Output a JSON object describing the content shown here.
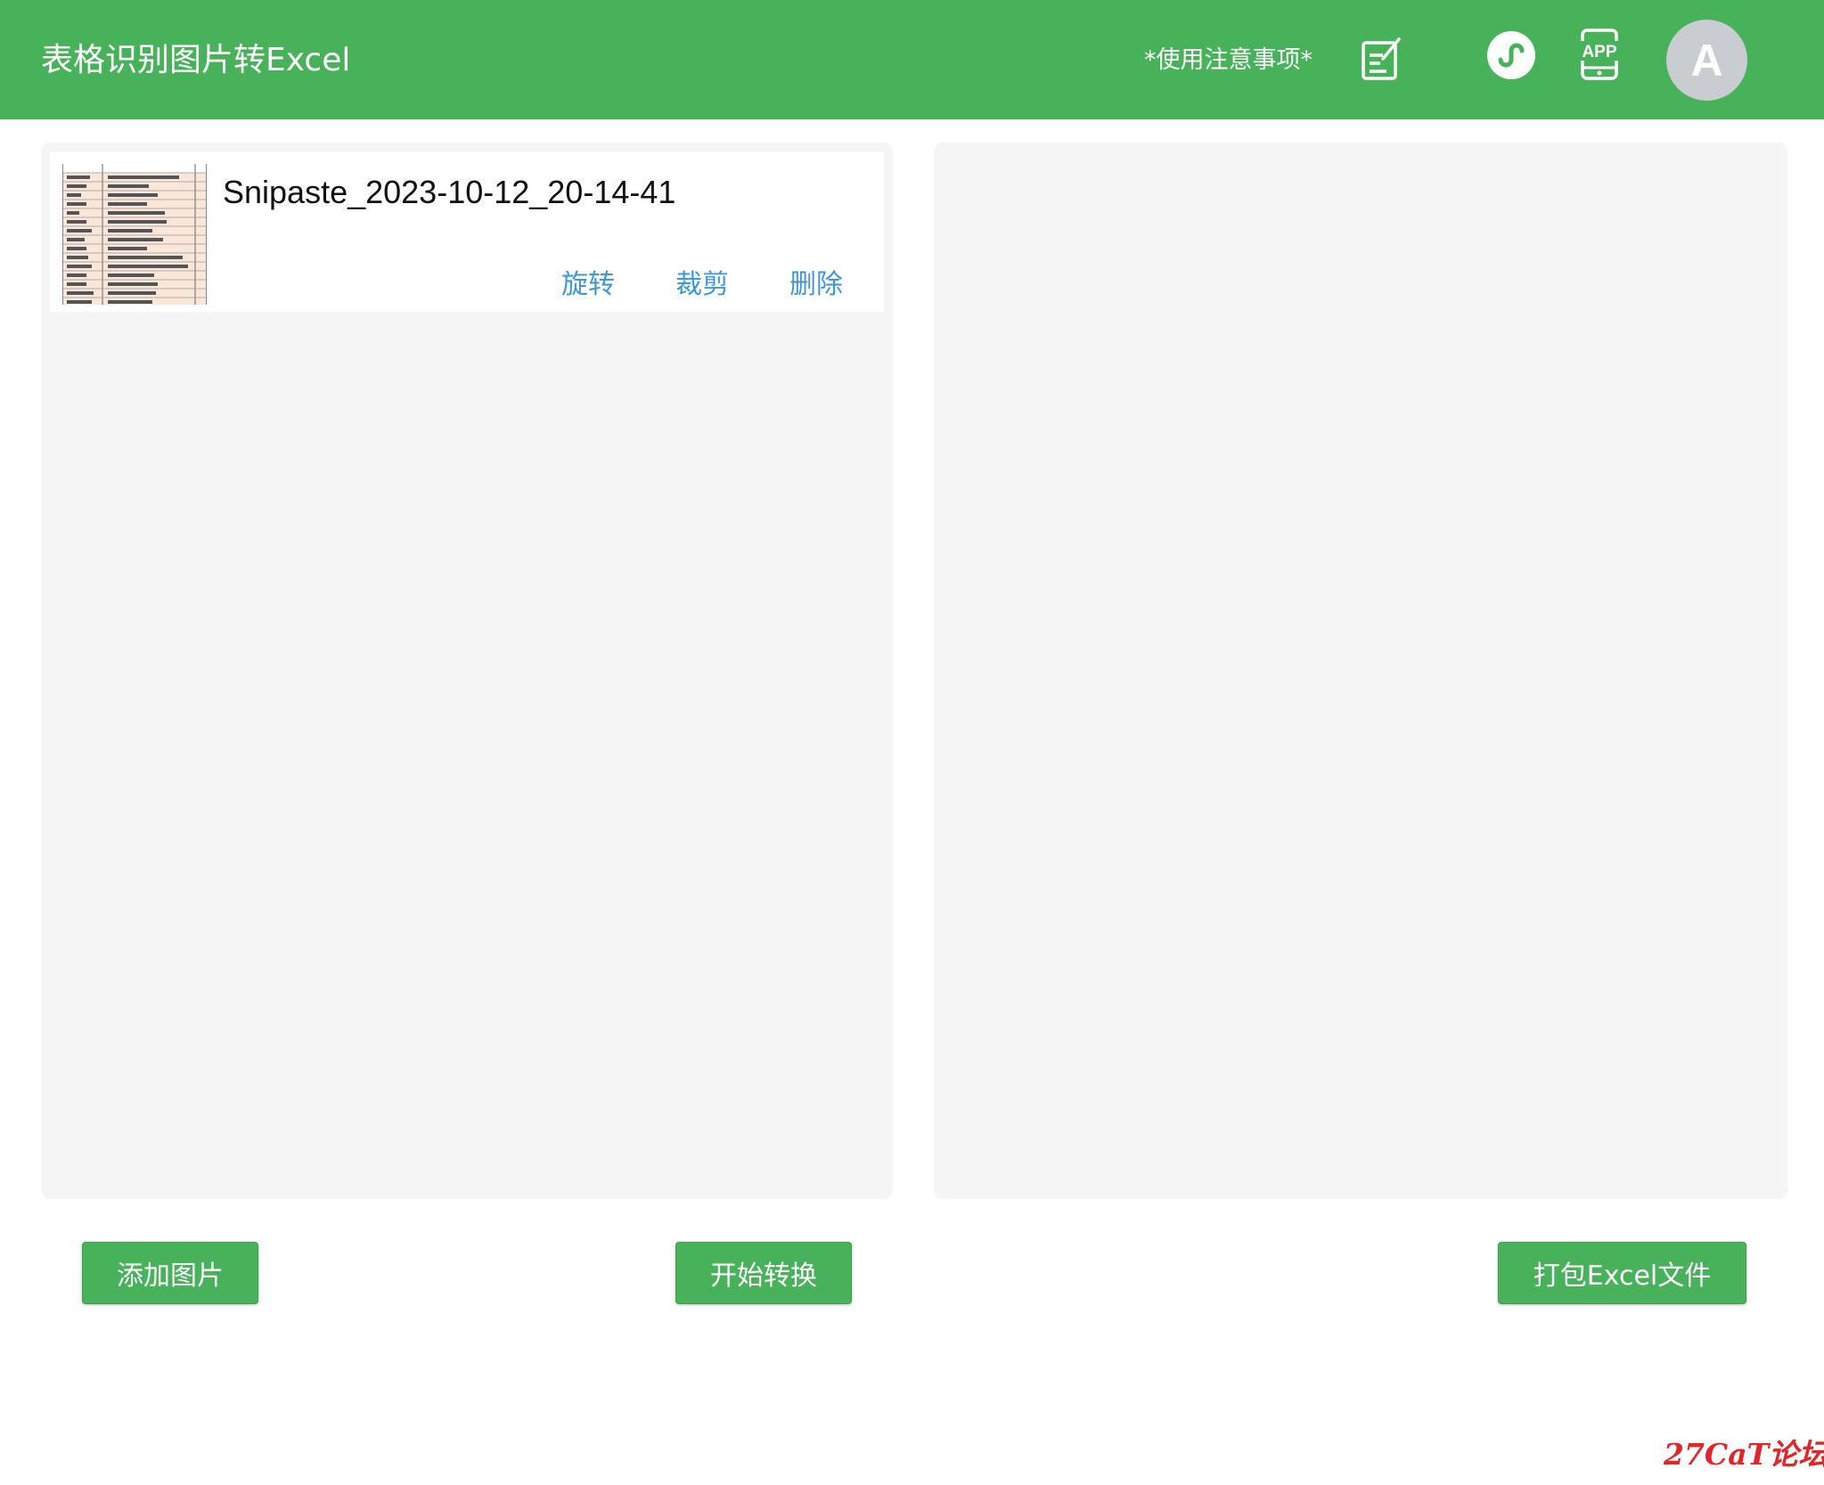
{
  "header": {
    "title": "表格识别图片转Excel",
    "notice_link": "*使用注意事项*",
    "icons": [
      "note-edit-icon",
      "mini-program-link-icon",
      "app-download-icon"
    ],
    "avatar_letter": "A",
    "background": "#47b25a"
  },
  "files": [
    {
      "name": "Snipaste_2023-10-12_20-14-41",
      "actions": {
        "rotate": "旋转",
        "crop": "裁剪",
        "delete": "删除"
      }
    }
  ],
  "buttons": {
    "add_image": "添加图片",
    "start_convert": "开始转换",
    "pack_excel": "打包Excel文件"
  },
  "watermark": "27CaT论坛",
  "colors": {
    "accent": "#47b25a",
    "link": "#3f97d6",
    "panel": "#f5f5f5",
    "watermark": "#e0262b"
  }
}
